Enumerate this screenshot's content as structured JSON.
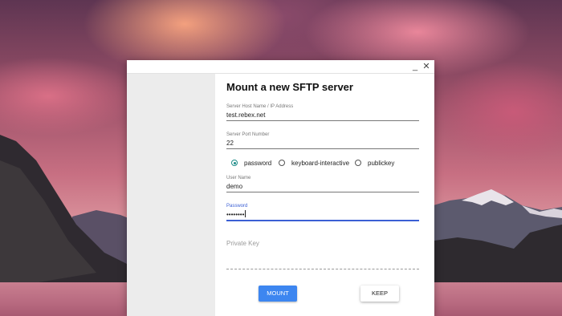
{
  "window": {
    "minimize_glyph": "_",
    "close_glyph": "✕"
  },
  "form": {
    "title": "Mount a new SFTP server",
    "host": {
      "label": "Server Host Name / IP Address",
      "value": "test.rebex.net"
    },
    "port": {
      "label": "Server Port Number",
      "value": "22"
    },
    "auth": {
      "options": [
        "password",
        "keyboard-interactive",
        "publickey"
      ],
      "selected": "password"
    },
    "username": {
      "label": "User Name",
      "value": "demo"
    },
    "password": {
      "label": "Password",
      "value": "••••••••"
    },
    "private_key": {
      "label": "Private Key"
    },
    "mount_label": "MOUNT",
    "keep_label": "KEEP"
  },
  "colors": {
    "accent_blue": "#3d86f0",
    "focus_blue": "#3b5fd4",
    "radio_teal": "#1e8c88"
  }
}
